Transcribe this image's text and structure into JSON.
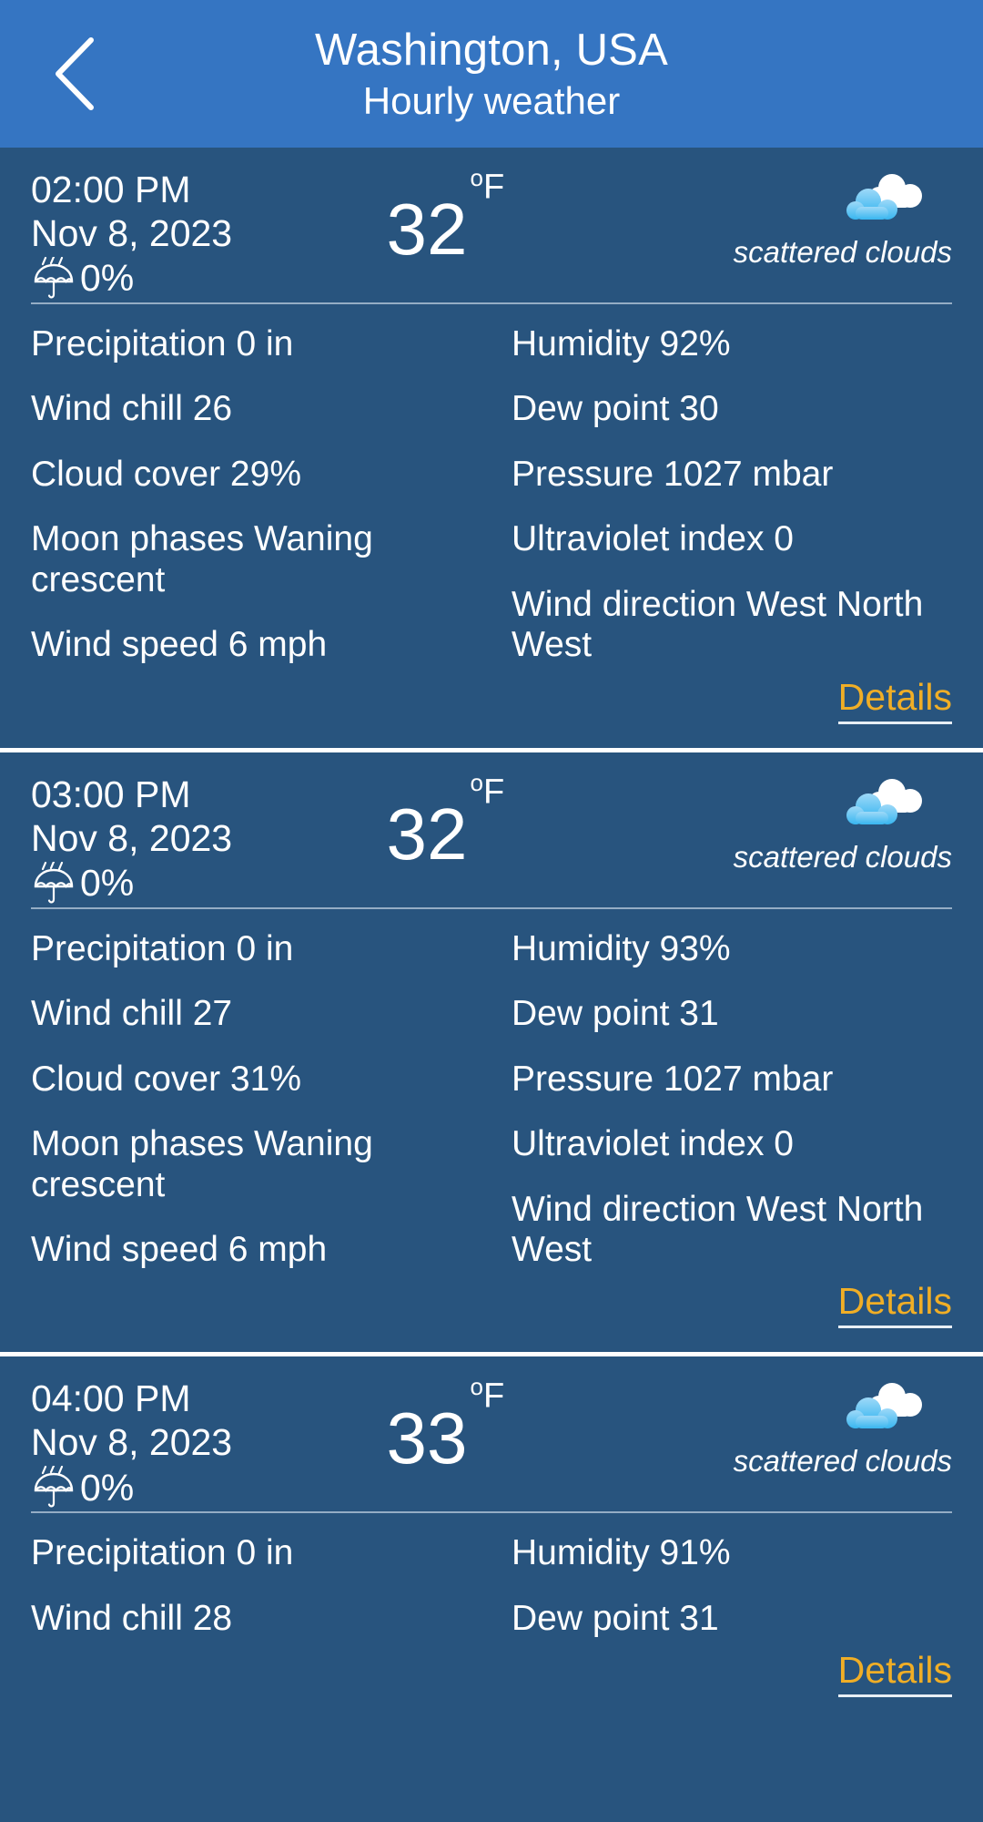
{
  "header": {
    "back_icon": "chevron-left-icon",
    "city": "Washington, USA",
    "subtitle": "Hourly weather"
  },
  "labels": {
    "details": "Details",
    "degree_symbol": "o",
    "unit": "F",
    "precip_icon": "umbrella-rain-icon",
    "condition_icon": "scattered-clouds-icon"
  },
  "colors": {
    "header_blue": "#3575c2",
    "card_background": "#28547e",
    "text_white": "#ffffff",
    "details_amber": "#f0ae26",
    "divider": "#b9cbdd",
    "cloud_white": "#ffffff",
    "cloud_blue": "#5cc3f5"
  },
  "hours": [
    {
      "time": "02:00 PM",
      "date": "Nov 8, 2023",
      "precip_chance": "0%",
      "temperature": "32",
      "unit": "F",
      "condition": "scattered clouds",
      "left_rows": [
        "Precipitation 0 in",
        "Wind chill 26",
        "Cloud cover 29%",
        "Moon phases Waning crescent",
        "Wind speed 6 mph"
      ],
      "right_rows": [
        "Humidity 92%",
        "Dew point 30",
        "Pressure 1027 mbar",
        "Ultraviolet index 0",
        "Wind direction West North West"
      ],
      "details_label": "Details"
    },
    {
      "time": "03:00 PM",
      "date": "Nov 8, 2023",
      "precip_chance": "0%",
      "temperature": "32",
      "unit": "F",
      "condition": "scattered clouds",
      "left_rows": [
        "Precipitation 0 in",
        "Wind chill 27",
        "Cloud cover 31%",
        "Moon phases Waning crescent",
        "Wind speed 6 mph"
      ],
      "right_rows": [
        "Humidity 93%",
        "Dew point 31",
        "Pressure 1027 mbar",
        "Ultraviolet index 0",
        "Wind direction West North West"
      ],
      "details_label": "Details"
    },
    {
      "time": "04:00 PM",
      "date": "Nov 8, 2023",
      "precip_chance": "0%",
      "temperature": "33",
      "unit": "F",
      "condition": "scattered clouds",
      "left_rows": [
        "Precipitation 0 in",
        "Wind chill 28"
      ],
      "right_rows": [
        "Humidity 91%",
        "Dew point 31"
      ],
      "details_label": "Details"
    }
  ]
}
